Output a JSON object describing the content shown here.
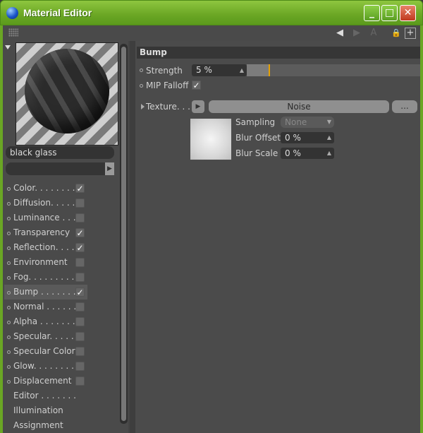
{
  "window": {
    "title": "Material Editor",
    "min": "_",
    "max": "□",
    "close": "✕"
  },
  "toolbar": {
    "back": "◀",
    "forward": "▶",
    "pin": "A",
    "lock": "🔒",
    "new": "+"
  },
  "material": {
    "name": "black glass"
  },
  "channels": [
    {
      "label": "Color. . . . . . . .",
      "checked": true,
      "selected": false
    },
    {
      "label": "Diffusion. . . . .",
      "checked": false,
      "selected": false
    },
    {
      "label": "Luminance . . .",
      "checked": false,
      "selected": false
    },
    {
      "label": "Transparency",
      "checked": true,
      "selected": false
    },
    {
      "label": "Reflection. . . .",
      "checked": true,
      "selected": false
    },
    {
      "label": "Environment",
      "checked": false,
      "selected": false
    },
    {
      "label": "Fog. . . . . . . . .",
      "checked": false,
      "selected": false
    },
    {
      "label": "Bump . . . . . . .",
      "checked": true,
      "selected": true
    },
    {
      "label": "Normal . . . . . .",
      "checked": false,
      "selected": false
    },
    {
      "label": "Alpha . . . . . . .",
      "checked": false,
      "selected": false
    },
    {
      "label": "Specular. . . . .",
      "checked": false,
      "selected": false
    },
    {
      "label": "Specular Color",
      "checked": false,
      "selected": false
    },
    {
      "label": "Glow. . . . . . . .",
      "checked": false,
      "selected": false
    },
    {
      "label": "Displacement",
      "checked": false,
      "selected": false
    },
    {
      "label": "Editor . . . . . . .",
      "checked": null,
      "selected": false
    },
    {
      "label": "Illumination",
      "checked": null,
      "selected": false
    },
    {
      "label": "Assignment",
      "checked": null,
      "selected": false
    }
  ],
  "bump": {
    "header": "Bump",
    "strength_label": "Strength",
    "strength_value": "5 %",
    "strength_fraction": 0.05,
    "mip_label": "MIP Falloff",
    "mip_checked": "✓",
    "texture_label": "Texture. . .",
    "texture_name": "Noise",
    "more_button": "...",
    "sampling_label": "Sampling",
    "sampling_value": "None",
    "blur_offset_label": "Blur Offset",
    "blur_offset_value": "0 %",
    "blur_scale_label": "Blur Scale",
    "blur_scale_value": "0 %"
  },
  "colors": {
    "accent": "#e5a000",
    "titlebar": "#6aa624"
  }
}
